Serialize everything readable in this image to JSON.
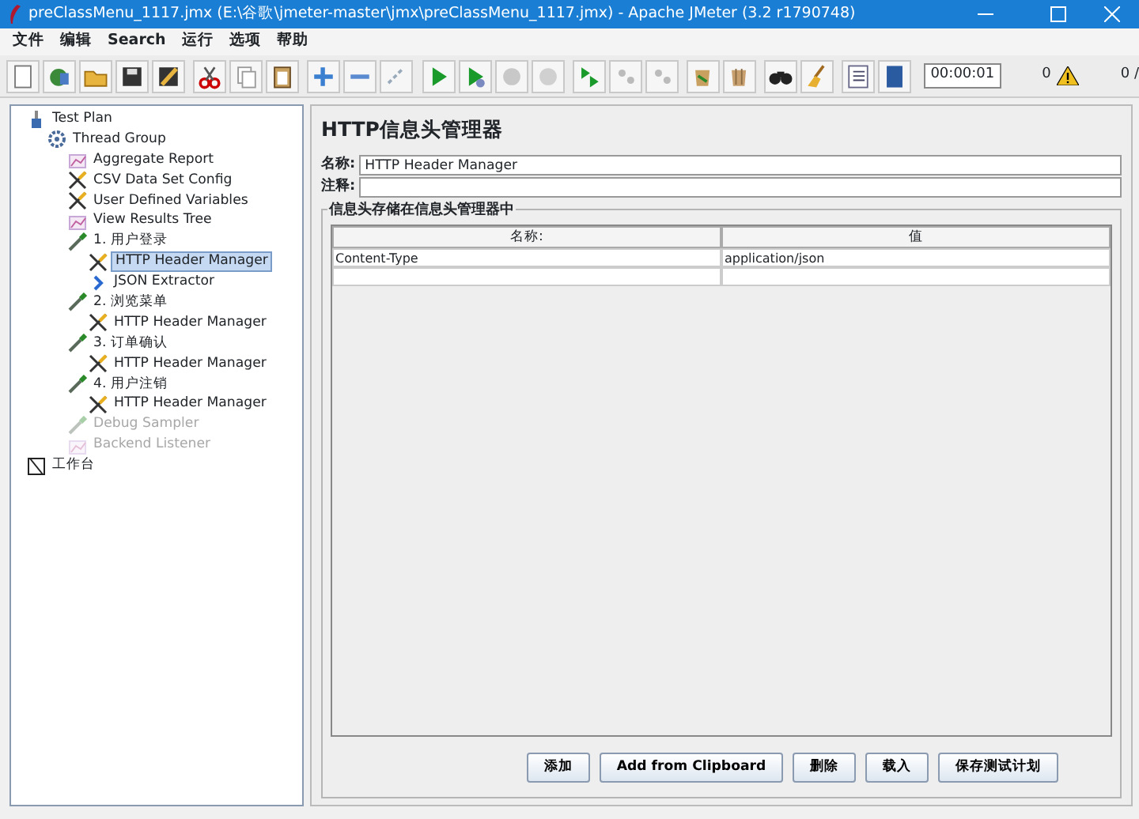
{
  "window": {
    "title": "preClassMenu_1117.jmx (E:\\谷歌\\jmeter-master\\jmx\\preClassMenu_1117.jmx) - Apache JMeter (3.2 r1790748)"
  },
  "menu": [
    "文件",
    "编辑",
    "Search",
    "运行",
    "选项",
    "帮助"
  ],
  "toolbar": {
    "timer": "00:00:01",
    "warnings": "0",
    "threads": "0 /"
  },
  "tree": [
    {
      "label": "Test Plan",
      "kind": "plan",
      "selected": false,
      "disabled": false,
      "children": [
        {
          "label": "Thread Group",
          "kind": "group",
          "selected": false,
          "disabled": false,
          "children": [
            {
              "label": "Aggregate Report",
              "kind": "listener",
              "selected": false,
              "disabled": false
            },
            {
              "label": "CSV Data Set Config",
              "kind": "config",
              "selected": false,
              "disabled": false
            },
            {
              "label": "User Defined Variables",
              "kind": "config",
              "selected": false,
              "disabled": false
            },
            {
              "label": "View Results Tree",
              "kind": "listener",
              "selected": false,
              "disabled": false
            },
            {
              "label": "1. 用户登录",
              "kind": "sampler",
              "selected": false,
              "disabled": false,
              "children": [
                {
                  "label": "HTTP Header Manager",
                  "kind": "config",
                  "selected": true,
                  "disabled": false
                },
                {
                  "label": "JSON Extractor",
                  "kind": "extractor",
                  "selected": false,
                  "disabled": false
                }
              ]
            },
            {
              "label": "2. 浏览菜单",
              "kind": "sampler",
              "selected": false,
              "disabled": false,
              "children": [
                {
                  "label": "HTTP Header Manager",
                  "kind": "config",
                  "selected": false,
                  "disabled": false
                }
              ]
            },
            {
              "label": "3. 订单确认",
              "kind": "sampler",
              "selected": false,
              "disabled": false,
              "children": [
                {
                  "label": "HTTP Header Manager",
                  "kind": "config",
                  "selected": false,
                  "disabled": false
                }
              ]
            },
            {
              "label": "4. 用户注销",
              "kind": "sampler",
              "selected": false,
              "disabled": false,
              "children": [
                {
                  "label": "HTTP Header Manager",
                  "kind": "config",
                  "selected": false,
                  "disabled": false
                }
              ]
            },
            {
              "label": "Debug Sampler",
              "kind": "sampler",
              "selected": false,
              "disabled": true
            },
            {
              "label": "Backend Listener",
              "kind": "listener",
              "selected": false,
              "disabled": true
            }
          ]
        }
      ]
    },
    {
      "label": "工作台",
      "kind": "workbench",
      "selected": false,
      "disabled": false
    }
  ],
  "editor": {
    "title": "HTTP信息头管理器",
    "name_label": "名称:",
    "name_value": "HTTP Header Manager",
    "comment_label": "注释:",
    "group_title": "信息头存储在信息头管理器中",
    "columns": [
      "名称:",
      "值"
    ],
    "rows": [
      [
        "Content-Type",
        "application/json"
      ]
    ],
    "buttons": [
      "添加",
      "Add from Clipboard",
      "删除",
      "载入",
      "保存测试计划"
    ]
  }
}
